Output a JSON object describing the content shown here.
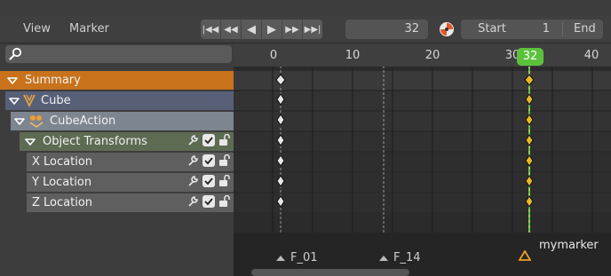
{
  "header": {
    "menu": [
      "View",
      "Marker"
    ],
    "playback_buttons": [
      "jump-start",
      "jump-prev-keyframe",
      "play-reverse",
      "play",
      "jump-next-keyframe",
      "jump-end"
    ],
    "current_frame": "32",
    "start_label": "Start",
    "start_value": "1",
    "end_label": "End"
  },
  "search": {
    "placeholder": ""
  },
  "channels": [
    {
      "label": "Summary",
      "type": "summary"
    },
    {
      "label": "Cube",
      "type": "object"
    },
    {
      "label": "CubeAction",
      "type": "action"
    },
    {
      "label": "Object Transforms",
      "type": "group"
    },
    {
      "label": "X Location",
      "type": "fcurve"
    },
    {
      "label": "Y Location",
      "type": "fcurve"
    },
    {
      "label": "Z Location",
      "type": "fcurve"
    }
  ],
  "timeline": {
    "ruler_labels": [
      "0",
      "10",
      "20",
      "30",
      "40"
    ],
    "current_frame": "32",
    "keyframe_frames": [
      1,
      32
    ],
    "rows_with_keys": 7
  },
  "markers": [
    {
      "name": "F_01",
      "frame": 1
    },
    {
      "name": "F_14",
      "frame": 14
    },
    {
      "name": "mymarker",
      "frame": 32
    }
  ],
  "colors": {
    "summary_bg": "#c8731c",
    "object_bg": "#586078",
    "action_bg": "#7c8590",
    "group_bg": "#5d6b53",
    "fcurve_bg": "#5f5f5f",
    "playhead": "#5cc23c",
    "keyframe_selected": "#e7b826",
    "marker_selected": "#f0a020"
  }
}
